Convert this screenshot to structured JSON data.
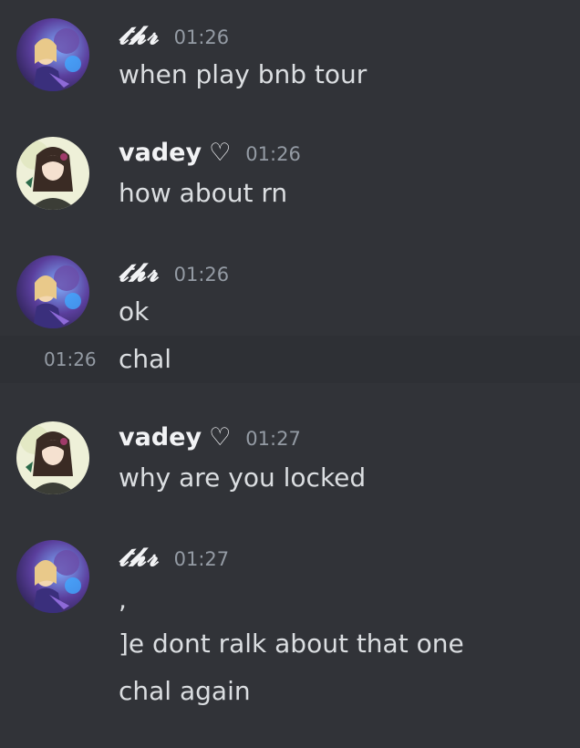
{
  "messages": [
    {
      "author": "𝓽𝓱𝓻",
      "time": "01:26",
      "lines": [
        "when play bnb tour"
      ]
    },
    {
      "author": "vadey",
      "author_suffix": "♡",
      "time": "01:26",
      "lines": [
        "how about rn"
      ]
    },
    {
      "author": "𝓽𝓱𝓻",
      "time": "01:26",
      "lines": [
        "ok"
      ],
      "followups": [
        {
          "time": "01:26",
          "text": "chal"
        }
      ]
    },
    {
      "author": "vadey",
      "author_suffix": "♡",
      "time": "01:27",
      "lines": [
        "why are you locked"
      ]
    },
    {
      "author": "𝓽𝓱𝓻",
      "time": "01:27",
      "lines": [
        ","
      ],
      "followups": [
        {
          "text": "]e dont ralk about that one"
        },
        {
          "text": "chal again"
        }
      ]
    }
  ],
  "colors": {
    "background": "#313338",
    "username": "#f2f3f5",
    "timestamp": "#949ba4",
    "message_text": "#dbdee1"
  },
  "icons": {
    "thr_avatar": "anime-avatar-blonde-girl-purple-background",
    "vadey_avatar": "anime-avatar-dark-hair-girl-light-background"
  }
}
